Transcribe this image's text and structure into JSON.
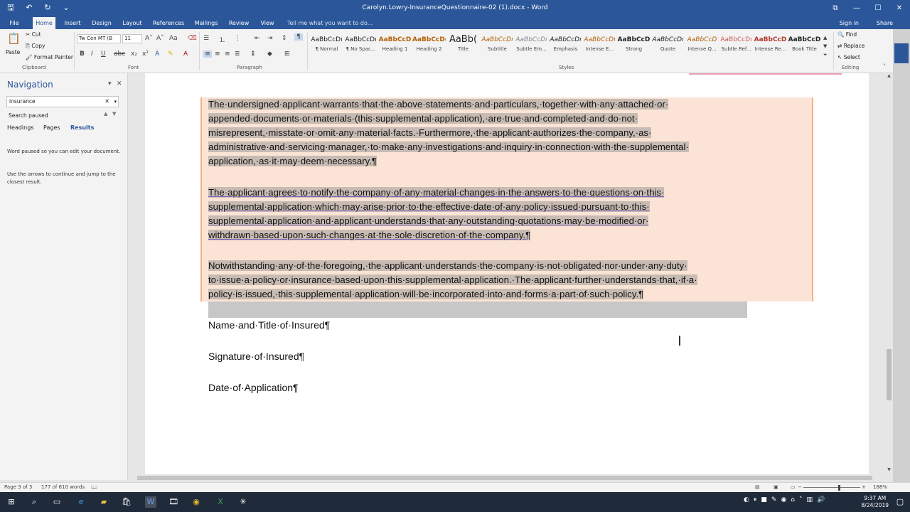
{
  "window": {
    "title": "Carolyn.Lowry-InsuranceQuestionnaire-02 (1).docx - Word",
    "controls": [
      "⧉",
      "—",
      "☐",
      "✕"
    ]
  },
  "qat": {
    "save": "🖫",
    "undo": "↶",
    "redo": "↻",
    "customize": "⌄"
  },
  "tabs": [
    "File",
    "Home",
    "Insert",
    "Design",
    "Layout",
    "References",
    "Mailings",
    "Review",
    "View"
  ],
  "tell_me": "Tell me what you want to do...",
  "sign_in": "Sign in",
  "share": "Share",
  "ribbon": {
    "clipboard": {
      "label": "Clipboard",
      "paste": "Paste",
      "cut": "Cut",
      "copy": "Copy",
      "format_painter": "Format Painter"
    },
    "font": {
      "label": "Font",
      "name": "Tw Cen MT (B",
      "size": "11"
    },
    "paragraph": {
      "label": "Paragraph"
    },
    "styles": {
      "label": "Styles",
      "items": [
        {
          "sample": "AaBbCcDı",
          "name": "¶ Normal"
        },
        {
          "sample": "AaBbCcDı",
          "name": "¶ No Spac..."
        },
        {
          "sample": "AaBbCcD",
          "name": "Heading 1"
        },
        {
          "sample": "AaBbCcDd",
          "name": "Heading 2"
        },
        {
          "sample": "AaBb(",
          "name": "Title"
        },
        {
          "sample": "AaBbCcDı",
          "name": "Subtitle"
        },
        {
          "sample": "AaBbCcDı",
          "name": "Subtle Em..."
        },
        {
          "sample": "AaBbCcDı",
          "name": "Emphasis"
        },
        {
          "sample": "AaBbCcDı",
          "name": "Intense E..."
        },
        {
          "sample": "AaBbCcD",
          "name": "Strong"
        },
        {
          "sample": "AaBbCcDı",
          "name": "Quote"
        },
        {
          "sample": "AaBbCcD",
          "name": "Intense Q..."
        },
        {
          "sample": "AaBbCcDı",
          "name": "Subtle Ref..."
        },
        {
          "sample": "AaBbCcD",
          "name": "Intense Re..."
        },
        {
          "sample": "AaBbCcD",
          "name": "Book Title"
        }
      ]
    },
    "editing": {
      "label": "Editing",
      "find": "Find",
      "replace": "Replace",
      "select": "Select"
    }
  },
  "navigation": {
    "title": "Navigation",
    "search_value": "insurance",
    "status": "Search paused",
    "tabs": [
      "Headings",
      "Pages",
      "Results"
    ],
    "message1": "Word paused so you can edit your document.",
    "message2": "Use the arrows to continue and jump to the closest result."
  },
  "document": {
    "para1": [
      "The·undersigned·applicant·warrants·that·the·above·statements·and·particulars,·together·with·any·attached·or·",
      "appended·documents·or·materials·(this·supplemental·application),·are·true·and·completed·and·do·not·",
      "misrepresent,·misstate·or·omit·any·material·facts.·Furthermore,·the·applicant·authorizes·the·company,·as·",
      "administrative·and·servicing·manager,·to·make·any·investigations·and·inquiry·in·connection·with·the·supplemental·",
      "application,·as·it·may·deem·necessary.¶"
    ],
    "para2": [
      "The·applicant·agrees·to·notify·the·company·of·any·material·changes·in·the·answers·to·the·questions·on·this·",
      "supplemental·application·which·may·arise·prior·to·the·effective·date·of·any·policy·issued·pursuant·to·this·",
      "supplemental·application·and·applicant·understands·that·any·outstanding·quotations·may·be·modified·or·",
      "withdrawn·based·upon·such·changes·at·the·sole·discretion·of·the·company.¶"
    ],
    "para3": [
      "Notwithstanding·any·of·the·foregoing,·the·applicant·understands·the·company·is·not·obligated·nor·under·any·duty·",
      "to·issue·a·policy·or·insurance·based·upon·this·supplemental·application.·The·applicant·further·understands·that,·if·a·",
      "policy·is·issued,·this·supplemental·application·will·be·incorporated·into·and·forms·a·part·of·such·policy.¶"
    ],
    "name_title": "Name·and·Title·of·Insured¶",
    "signature": "Signature·of·Insured¶",
    "date": "Date·of·Application¶"
  },
  "statusbar": {
    "page": "Page 3 of 3",
    "words": "177 of 610 words",
    "zoom": "188%"
  },
  "taskbar": {
    "time": "9:37 AM",
    "date": "8/24/2019"
  },
  "colors": {
    "word_blue": "#2b579a",
    "selection_highlight": "#fbe4d5",
    "selection_border": "#f4b183"
  }
}
